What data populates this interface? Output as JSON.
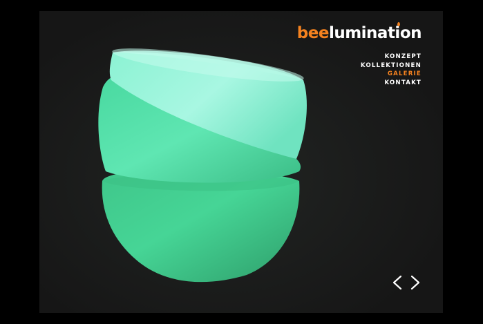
{
  "brand": {
    "prefix": "bee",
    "suffix": "lumination",
    "accent_color": "#f5821f",
    "text_color": "#ffffff"
  },
  "nav": {
    "items": [
      {
        "label": "KONZEPT",
        "active": false
      },
      {
        "label": "KOLLEKTIONEN",
        "active": false
      },
      {
        "label": "GALERIE",
        "active": true
      },
      {
        "label": "KONTAKT",
        "active": false
      }
    ]
  },
  "gallery": {
    "image_subject": "stacked-glowing-bowls",
    "prev_icon": "chevron-left-icon",
    "next_icon": "chevron-right-icon"
  },
  "colors": {
    "page_background": "#000000",
    "stage_background": "#191919",
    "glow_green": "#4fd99a"
  }
}
